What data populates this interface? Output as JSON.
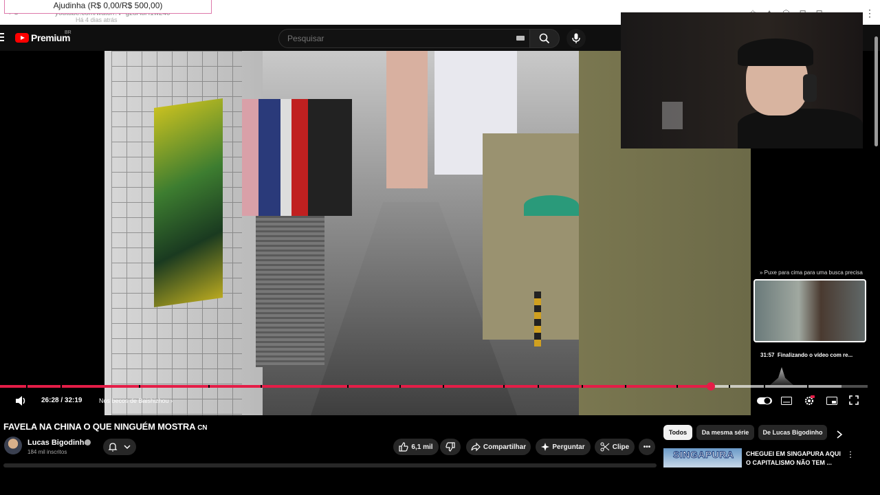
{
  "browser": {
    "donation_label": "Ajudinha (R$ 0,00/R$ 500,00)",
    "url": "youtube.com/watch?v=gz8AuH1w240",
    "url_sub": "Há 4 dias atrás"
  },
  "header": {
    "logo_text": "Premium",
    "country_code": "BR",
    "search_placeholder": "Pesquisar"
  },
  "player": {
    "current_time": "26:28",
    "duration": "32:19",
    "time_display": "26:28 / 32:19",
    "progress_fraction": 0.819,
    "buffer_fraction": 0.97,
    "chapter": "Nos becos de Baishizhou",
    "scrub_hint": "Puxe para cima para uma busca precisa",
    "preview_time": "31:57",
    "preview_label": "Finalizando o vídeo com re..."
  },
  "video": {
    "title": "FAVELA NA CHINA O QUE NINGUÉM MOSTRA",
    "title_flag": "CN",
    "channel": "Lucas Bigodinho",
    "subscribers": "184 mil inscritos",
    "likes": "6,1 mil",
    "share_label": "Compartilhar",
    "ask_label": "Perguntar",
    "clip_label": "Clipe"
  },
  "sidebar": {
    "chips": [
      "Todos",
      "Da mesma série",
      "De Lucas Bigodinho"
    ],
    "related": {
      "thumb_text": "SINGAPURA",
      "title": "CHEGUEI EM SINGAPURA AQUI O CAPITALISMO NÃO TEM ..."
    }
  },
  "colors": {
    "progress": "#e41d47",
    "youtube_red": "#ff0000",
    "background": "#0f0f0f"
  }
}
